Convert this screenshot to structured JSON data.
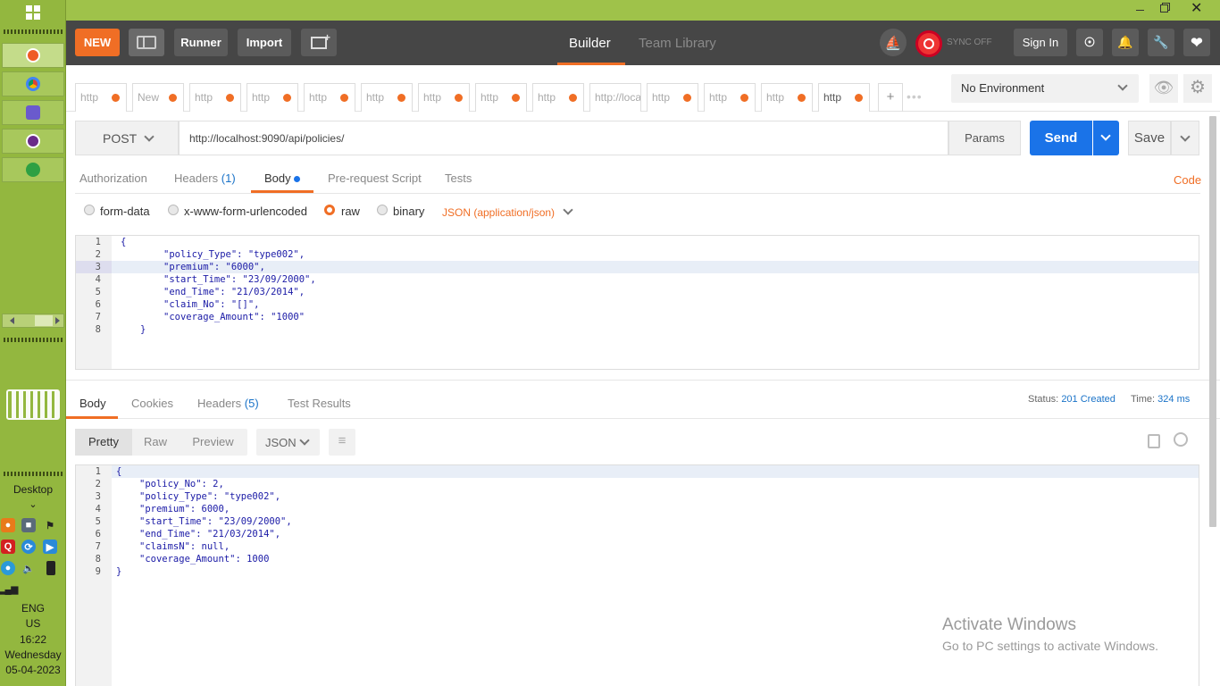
{
  "taskbar": {
    "desktop_label": "Desktop",
    "lang": "ENG",
    "region": "US",
    "time": "16:22",
    "day": "Wednesday",
    "date": "05-04-2023"
  },
  "toolbar": {
    "new_label": "NEW",
    "runner_label": "Runner",
    "import_label": "Import",
    "builder_label": "Builder",
    "team_library_label": "Team Library",
    "sync_label": "SYNC OFF",
    "sign_in_label": "Sign In"
  },
  "request_tabs": [
    "http",
    "New",
    "http",
    "http",
    "http",
    "http",
    "http",
    "http",
    "http",
    "http://loca",
    "http",
    "http",
    "http",
    "http"
  ],
  "environment": {
    "selected": "No Environment"
  },
  "request": {
    "method": "POST",
    "url": "http://localhost:9090/api/policies/",
    "params_label": "Params",
    "send_label": "Send",
    "save_label": "Save"
  },
  "req_tabs": {
    "authorization": "Authorization",
    "headers": "Headers",
    "headers_count": "(1)",
    "body": "Body",
    "prerequest": "Pre-request Script",
    "tests": "Tests",
    "code": "Code"
  },
  "body_modes": {
    "form_data": "form-data",
    "urlencoded": "x-www-form-urlencoded",
    "raw": "raw",
    "binary": "binary",
    "content_type": "JSON (application/json)"
  },
  "request_body": {
    "line_numbers": [
      "1",
      "2",
      "3",
      "4",
      "5",
      "6",
      "7",
      "8"
    ],
    "lines": [
      "{",
      "\"policy_Type\": \"type002\",",
      "\"premium\": \"6000\",",
      "\"start_Time\": \"23/09/2000\",",
      "\"end_Time\": \"21/03/2014\",",
      "\"claim_No\": \"[]\",",
      "\"coverage_Amount\": \"1000\"",
      "}"
    ]
  },
  "response_tabs": {
    "body": "Body",
    "cookies": "Cookies",
    "headers": "Headers",
    "headers_count": "(5)",
    "test_results": "Test Results",
    "status_label": "Status:",
    "status_value": "201 Created",
    "time_label": "Time:",
    "time_value": "324 ms"
  },
  "response_view": {
    "pretty": "Pretty",
    "raw": "Raw",
    "preview": "Preview",
    "format": "JSON"
  },
  "response_body": {
    "line_numbers": [
      "1",
      "2",
      "3",
      "4",
      "5",
      "6",
      "7",
      "8",
      "9"
    ],
    "lines": [
      "{",
      "\"policy_No\": 2,",
      "\"policy_Type\": \"type002\",",
      "\"premium\": 6000,",
      "\"start_Time\": \"23/09/2000\",",
      "\"end_Time\": \"21/03/2014\",",
      "\"claimsN\": null,",
      "\"coverage_Amount\": 1000",
      "}"
    ]
  },
  "watermark": {
    "title": "Activate Windows",
    "subtitle": "Go to PC settings to activate Windows."
  },
  "colors": {
    "accent_orange": "#f06e25",
    "send_blue": "#1a73e8",
    "toolbar_bg": "#464646",
    "taskbar_green": "#93b73f"
  }
}
